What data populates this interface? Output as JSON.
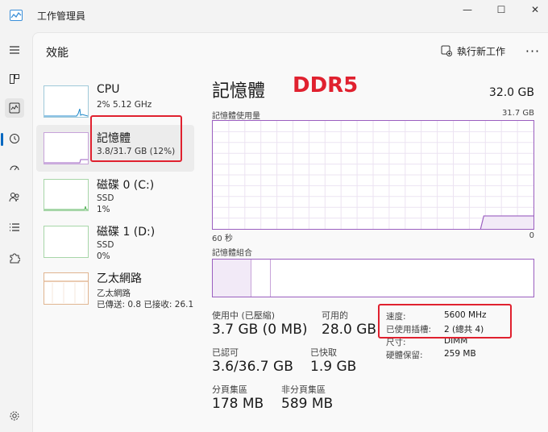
{
  "window": {
    "title": "工作管理員",
    "min": "—",
    "max": "☐",
    "close": "✕"
  },
  "header": {
    "title": "效能",
    "run_task_label": "執行新工作",
    "more": "···"
  },
  "resources": [
    {
      "name": "CPU",
      "sub1": "2% 5.12 GHz",
      "sub2": ""
    },
    {
      "name": "記憶體",
      "sub1": "3.8/31.7 GB (12%)",
      "sub2": ""
    },
    {
      "name": "磁碟 0 (C:)",
      "sub1": "SSD",
      "sub2": "1%"
    },
    {
      "name": "磁碟 1 (D:)",
      "sub1": "SSD",
      "sub2": "0%"
    },
    {
      "name": "乙太網路",
      "sub1": "乙太網路",
      "sub2": "已傳送: 0.8 已接收: 26.1"
    }
  ],
  "detail": {
    "title": "記憶體",
    "annotation": "DDR5",
    "total": "32.0 GB",
    "usage_label": "記憶體使用量",
    "usage_max": "31.7 GB",
    "time_label": "60 秒",
    "time_zero": "0",
    "composition_label": "記憶體組合",
    "usage_fraction": 0.12,
    "stats": {
      "in_use_label": "使用中 (已壓縮)",
      "in_use_value": "3.7 GB (0 MB)",
      "available_label": "可用的",
      "available_value": "28.0 GB",
      "committed_label": "已認可",
      "committed_value": "3.6/36.7 GB",
      "cached_label": "已快取",
      "cached_value": "1.9 GB",
      "paged_label": "分頁集區",
      "paged_value": "178 MB",
      "nonpaged_label": "非分頁集區",
      "nonpaged_value": "589 MB"
    },
    "specs": [
      {
        "label": "速度:",
        "value": "5600 MHz"
      },
      {
        "label": "已使用插槽:",
        "value": "2 (總共 4)"
      },
      {
        "label": "尺寸:",
        "value": "DIMM"
      },
      {
        "label": "硬體保留:",
        "value": "259 MB"
      }
    ]
  },
  "colors": {
    "memory": "#9b5fc0",
    "cpu": "#1a86c8",
    "disk": "#4caf50",
    "network": "#c87533",
    "annotation": "#e0212f",
    "accent": "#0067c0"
  }
}
